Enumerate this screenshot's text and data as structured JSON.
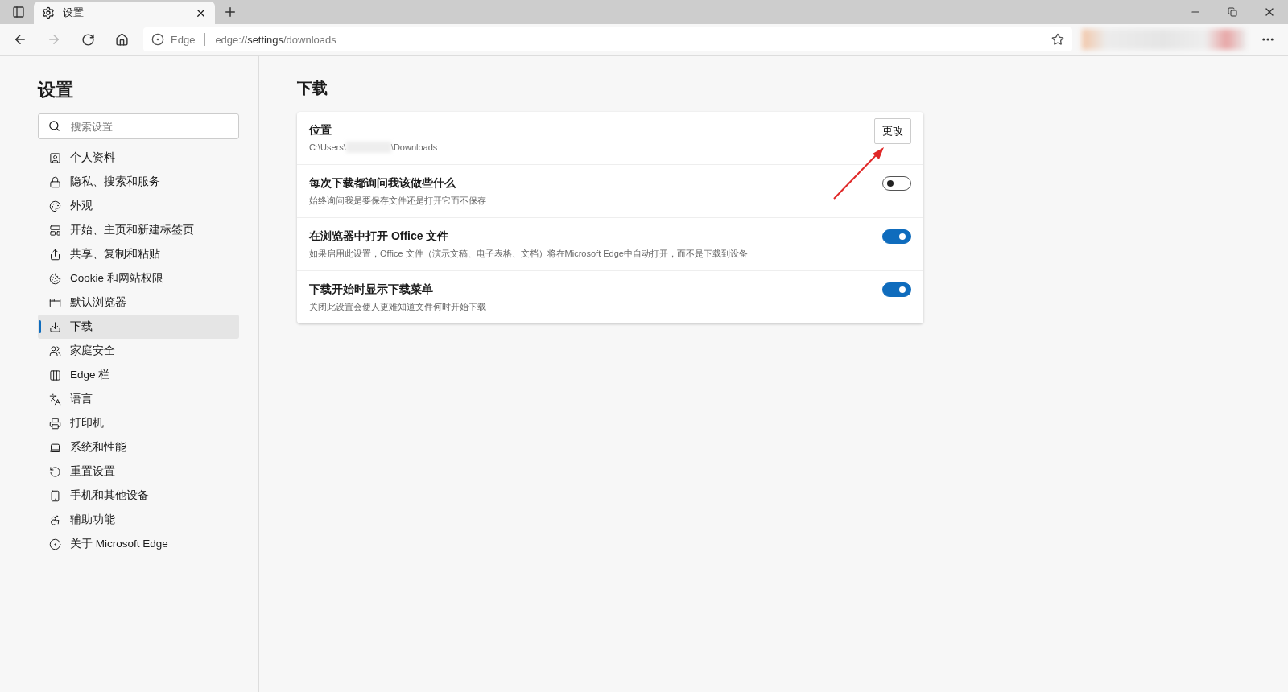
{
  "tab": {
    "title": "设置"
  },
  "address_bar": {
    "site": "Edge",
    "url_prefix": "edge://",
    "url_host": "settings",
    "url_path": "/downloads"
  },
  "sidebar": {
    "title": "设置",
    "search": {
      "placeholder": "搜索设置"
    },
    "items": [
      {
        "label": "个人资料",
        "selected": false
      },
      {
        "label": "隐私、搜索和服务",
        "selected": false
      },
      {
        "label": "外观",
        "selected": false
      },
      {
        "label": "开始、主页和新建标签页",
        "selected": false
      },
      {
        "label": "共享、复制和粘贴",
        "selected": false
      },
      {
        "label": "Cookie 和网站权限",
        "selected": false
      },
      {
        "label": "默认浏览器",
        "selected": false
      },
      {
        "label": "下载",
        "selected": true
      },
      {
        "label": "家庭安全",
        "selected": false
      },
      {
        "label": "Edge 栏",
        "selected": false
      },
      {
        "label": "语言",
        "selected": false
      },
      {
        "label": "打印机",
        "selected": false
      },
      {
        "label": "系统和性能",
        "selected": false
      },
      {
        "label": "重置设置",
        "selected": false
      },
      {
        "label": "手机和其他设备",
        "selected": false
      },
      {
        "label": "辅助功能",
        "selected": false
      },
      {
        "label": "关于 Microsoft Edge",
        "selected": false
      }
    ]
  },
  "page": {
    "title": "下载",
    "settings": [
      {
        "kind": "location",
        "title": "位置",
        "path_start": "C:\\Users\\",
        "path_end": "\\Downloads",
        "button": "更改"
      },
      {
        "kind": "toggle",
        "title": "每次下载都询问我该做些什么",
        "description": "始终询问我是要保存文件还是打开它而不保存",
        "on": false
      },
      {
        "kind": "toggle",
        "title": "在浏览器中打开 Office 文件",
        "description": "如果启用此设置，Office 文件（演示文稿、电子表格、文档）将在Microsoft Edge中自动打开，而不是下载到设备",
        "on": true
      },
      {
        "kind": "toggle",
        "title": "下载开始时显示下载菜单",
        "description": "关闭此设置会使人更难知道文件何时开始下载",
        "on": true
      }
    ]
  }
}
